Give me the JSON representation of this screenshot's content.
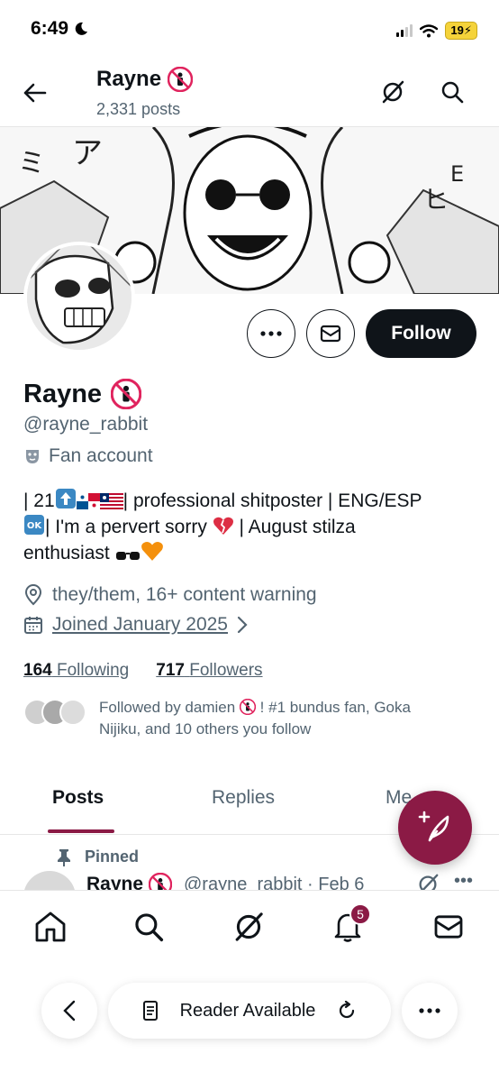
{
  "status_bar": {
    "time": "6:49",
    "battery": "19"
  },
  "header": {
    "name": "Rayne",
    "posts": "2,331 posts"
  },
  "profile": {
    "name": "Rayne",
    "handle": "@rayne_rabbit",
    "label": "Fan account",
    "follow_label": "Follow",
    "bio_1": "| 21",
    "bio_2": "| professional shitposter | ENG/ESP",
    "bio_3": "| I'm a pervert sorry",
    "bio_4": "| August stilza",
    "bio_5": "enthusiast",
    "pronouns": "they/them, 16+ content warning",
    "joined": "Joined January 2025",
    "following_count": "164",
    "following_label": "Following",
    "followers_count": "717",
    "followers_label": "Followers",
    "followed_by_1": "Followed by damien",
    "followed_by_2": "! #1 bundus fan, Goka Nijiku, and 10 others you follow"
  },
  "tabs": [
    "Posts",
    "Replies",
    "Me"
  ],
  "pinned": {
    "label": "Pinned",
    "author": "Rayne",
    "handle_date": "@rayne_rabbit · Feb 6",
    "more": "•••"
  },
  "nav": {
    "notifications_badge": "5"
  },
  "toolbar": {
    "reader": "Reader Available"
  },
  "colors": {
    "accent": "#8b1a45",
    "text": "#0f1419",
    "muted": "#536471",
    "follow_bg": "#0f1419"
  },
  "icons": [
    "back-arrow-icon",
    "no-litter-icon",
    "grok-icon",
    "search-icon",
    "more-icon",
    "mail-icon",
    "mask-icon",
    "location-icon",
    "calendar-icon",
    "chevron-right-icon",
    "compose-icon",
    "pin-icon",
    "home-icon",
    "bell-icon",
    "reader-icon",
    "reload-icon"
  ]
}
